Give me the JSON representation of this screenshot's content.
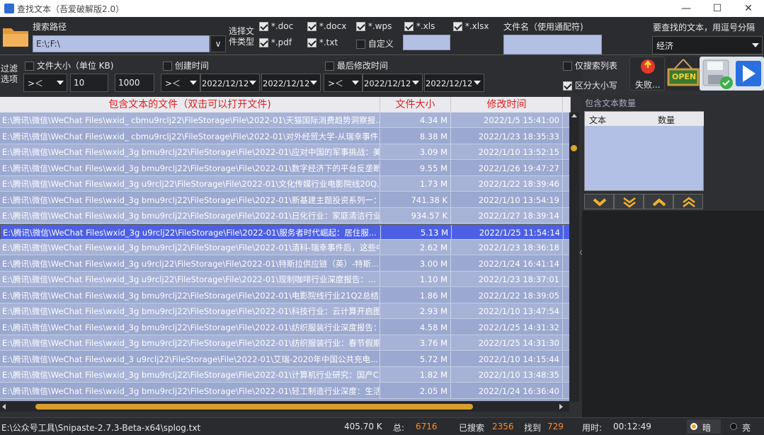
{
  "window": {
    "title": "查找文本（吾爱破解版2.0）"
  },
  "top": {
    "path_label": "搜索路径",
    "path_value": "E:\\;F:\\",
    "filetype_label": "选择文件类型",
    "types": [
      {
        "label": "*.doc",
        "on": true
      },
      {
        "label": "*.docx",
        "on": true
      },
      {
        "label": "*.wps",
        "on": true
      },
      {
        "label": "*.xls",
        "on": true
      },
      {
        "label": "*.xlsx",
        "on": true
      },
      {
        "label": "*.pdf",
        "on": true
      },
      {
        "label": "*.txt",
        "on": true
      },
      {
        "label": "自定义",
        "on": false
      }
    ],
    "filename_label": "文件名（使用通配符)",
    "search_label": "要查找的文本，用逗号分隔",
    "search_value": "经济"
  },
  "filter": {
    "label": "过滤选项",
    "size_label": "文件大小（单位 KB)",
    "size_op": ">＜",
    "size_min": "10",
    "size_max": "1000",
    "created_label": "创建时间",
    "created_op": ">＜",
    "created_from": "2022/12/12",
    "created_to": "2022/12/12",
    "modified_label": "最后修改时间",
    "modified_op": ">＜",
    "modified_from": "2022/12/12",
    "modified_to": "2022/12/12",
    "only_list_label": "仅搜索列表",
    "case_label": "区分大小写",
    "fail_label": "失败...",
    "open_label": "OPEN"
  },
  "table": {
    "headers": [
      "包含文本的文件（双击可以打开文件)",
      "文件大小",
      "修改时间"
    ],
    "rows": [
      {
        "path": "E:\\腾讯\\微信\\WeChat Files\\wxid_  cbmu9rclj22\\FileStorage\\File\\2022-01\\天猫国际消费趋势洞察报...",
        "size": "4.34 M",
        "time": "2022/1/5 15:41:00"
      },
      {
        "path": "E:\\腾讯\\微信\\WeChat Files\\wxid_  cbmu9rclj22\\FileStorage\\File\\2022-01\\对外经贸大学-从瑞幸事件...",
        "size": "8.38 M",
        "time": "2022/1/23 18:35:33"
      },
      {
        "path": "E:\\腾讯\\微信\\WeChat Files\\wxid_3g  bmu9rclj22\\FileStorage\\File\\2022-01\\应对中国的军事挑战：美...",
        "size": "3.09 M",
        "time": "2022/1/10 13:52:15"
      },
      {
        "path": "E:\\腾讯\\微信\\WeChat Files\\wxid_3g  bmu9rclj22\\FileStorage\\File\\2022-01\\数字经济下的平台反垄断...",
        "size": "9.55 M",
        "time": "2022/1/26 19:47:27"
      },
      {
        "path": "E:\\腾讯\\微信\\WeChat Files\\wxid_3g  u9rclj22\\FileStorage\\File\\2022-01\\文化传媒行业电影院线20Q...",
        "size": "1.73 M",
        "time": "2022/1/22 18:39:46"
      },
      {
        "path": "E:\\腾讯\\微信\\WeChat Files\\wxid_3g  bmu9rclj22\\FileStorage\\File\\2022-01\\新基建主题投资系列一：...",
        "size": "741.38 K",
        "time": "2022/1/10 13:54:19"
      },
      {
        "path": "E:\\腾讯\\微信\\WeChat Files\\wxid_3g  bmu9rclj22\\FileStorage\\File\\2022-01\\日化行业：家庭清洁行业...",
        "size": "934.57 K",
        "time": "2022/1/27 18:39:14"
      },
      {
        "path": "E:\\腾讯\\微信\\WeChat Files\\wxid_3g  u9rclj22\\FileStorage\\File\\2022-01\\服务者时代崛起：居住服...",
        "size": "5.13 M",
        "time": "2022/1/25 11:54:14"
      },
      {
        "path": "E:\\腾讯\\微信\\WeChat Files\\wxid_3g  bmu9rclj22\\FileStorage\\File\\2022-01\\清科-瑞幸事件后，这些中...",
        "size": "2.62 M",
        "time": "2022/1/23 18:36:18"
      },
      {
        "path": "E:\\腾讯\\微信\\WeChat Files\\wxid_3g  u9rclj22\\FileStorage\\File\\2022-01\\特斯拉供应链（英）-特斯...",
        "size": "3.00 M",
        "time": "2022/1/24 16:41:14"
      },
      {
        "path": "E:\\腾讯\\微信\\WeChat Files\\wxid_3g  u9rclj22\\FileStorage\\File\\2022-01\\现制咖啡行业深度报告：...",
        "size": "1.10 M",
        "time": "2022/1/23 18:37:01"
      },
      {
        "path": "E:\\腾讯\\微信\\WeChat Files\\wxid_3g  bmu9rclj22\\FileStorage\\File\\2022-01\\电影院线行业21Q2总结与...",
        "size": "1.86 M",
        "time": "2022/1/22 18:39:05"
      },
      {
        "path": "E:\\腾讯\\微信\\WeChat Files\\wxid_3g  bmu9rclj22\\FileStorage\\File\\2022-01\\科技行业：云计算开启图...",
        "size": "2.93 M",
        "time": "2022/1/10 13:47:54"
      },
      {
        "path": "E:\\腾讯\\微信\\WeChat Files\\wxid_3g  bmu9rclj22\\FileStorage\\File\\2022-01\\纺织服装行业深度报告：...",
        "size": "4.58 M",
        "time": "2022/1/25 14:31:32"
      },
      {
        "path": "E:\\腾讯\\微信\\WeChat Files\\wxid_3g  bmu9rclj22\\FileStorage\\File\\2022-01\\纺织服装行业：春节假期...",
        "size": "3.76 M",
        "time": "2022/1/25 14:31:30"
      },
      {
        "path": "E:\\腾讯\\微信\\WeChat Files\\wxid_3  u9rclj22\\FileStorage\\File\\2022-01\\艾瑞-2020年中国公共充电...",
        "size": "5.72 M",
        "time": "2022/1/10 14:15:44"
      },
      {
        "path": "E:\\腾讯\\微信\\WeChat Files\\wxid_3g  bmu9rclj22\\FileStorage\\File\\2022-01\\计算机行业研究：国产CPU...",
        "size": "1.82 M",
        "time": "2022/1/10 13:48:35"
      },
      {
        "path": "E:\\腾讯\\微信\\WeChat Files\\wxid_3g  bmu9rclj22\\FileStorage\\File\\2022-01\\轻工制造行业深度：生活...",
        "size": "2.05 M",
        "time": "2022/1/24 16:36:40"
      }
    ]
  },
  "right": {
    "title": "包含文本数量",
    "col_text": "文本",
    "col_count": "数量"
  },
  "status": {
    "path": "E:\\公众号工具\\Snipaste-2.7.3-Beta-x64\\splog.txt",
    "size": "405.70 K",
    "total_label": "总:",
    "total": "6716",
    "searched_label": "已搜索",
    "searched": "2356",
    "found_label": "找到",
    "found": "729",
    "time_label": "用时:",
    "time": "00:12:49",
    "dark_label": "暗",
    "light_label": "亮"
  },
  "colors": {
    "accent_red": "#e02020",
    "selected_row": "#4d60e3",
    "status_num": "#ff8a2a"
  }
}
